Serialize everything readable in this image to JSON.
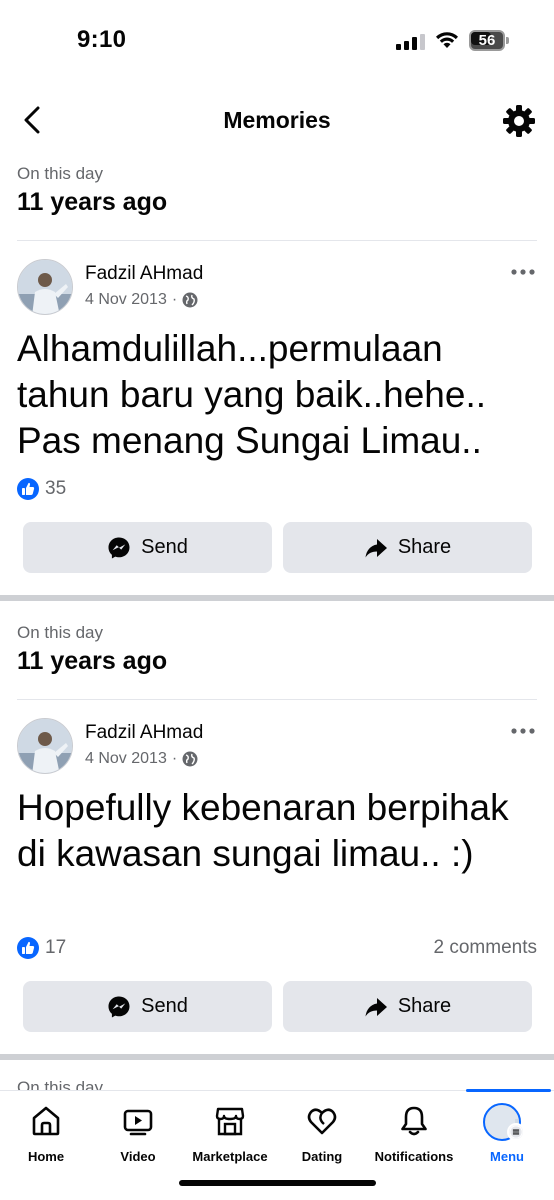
{
  "status_bar": {
    "time": "9:10",
    "battery": "56"
  },
  "header": {
    "title": "Memories"
  },
  "sections": [
    {
      "label": "On this day",
      "ago": "11 years ago",
      "post": {
        "author": "Fadzil AHmad",
        "date": "4 Nov 2013",
        "separator": "·",
        "text": "Alhamdulillah...permulaan tahun baru yang baik..hehe.. Pas menang Sungai Limau..",
        "likes": "35",
        "comments": "",
        "send_label": "Send",
        "share_label": "Share"
      }
    },
    {
      "label": "On this day",
      "ago": "11 years ago",
      "post": {
        "author": "Fadzil AHmad",
        "date": "4 Nov 2013",
        "separator": "·",
        "text": "Hopefully kebenaran berpihak di kawasan sungai limau.. :)",
        "likes": "17",
        "comments": "2 comments",
        "send_label": "Send",
        "share_label": "Share"
      }
    }
  ],
  "peek_label": "On this day",
  "bottom_nav": {
    "items": [
      {
        "label": "Home",
        "icon": "home-icon"
      },
      {
        "label": "Video",
        "icon": "video-icon"
      },
      {
        "label": "Marketplace",
        "icon": "marketplace-icon"
      },
      {
        "label": "Dating",
        "icon": "dating-icon"
      },
      {
        "label": "Notifications",
        "icon": "bell-icon"
      },
      {
        "label": "Menu",
        "icon": "menu-avatar",
        "active": true
      }
    ]
  },
  "colors": {
    "accent": "#0866ff",
    "secondary_text": "#65676b",
    "button_bg": "#e4e6eb"
  }
}
